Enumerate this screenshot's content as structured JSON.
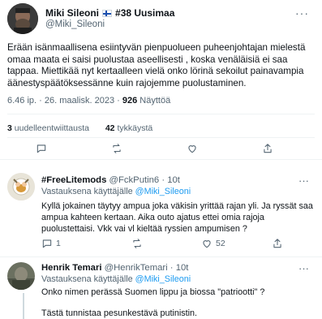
{
  "main_tweet": {
    "display_name": "Miki Sileoni",
    "badge": "#38 Uusimaa",
    "handle": "@Miki_Sileoni",
    "more_icon": "more-dots-icon",
    "text": "Erään isänmaallisena esiintyvän pienpuolueen puheenjohtajan mielestä omaa maata ei saisi puolustaa aseellisesti , koska venäläisiä ei saa tappaa. Miettikää nyt kertaalleen vielä onko lörinä sekoilut painavampia äänestyspäätöksessänne kuin rajojemme puolustaminen.",
    "time": "6.46 ip. · 26. maalisk. 2023 · ",
    "views_count": "926",
    "views_label": " Näyttöä",
    "retweets_count": "3",
    "retweets_label": " uudelleentwiittausta",
    "likes_count": "42",
    "likes_label": " tykkäystä"
  },
  "replies": [
    {
      "display_name": "#FreeLitemods",
      "handle_time": "@FckPutin6 · 10t",
      "replying_prefix": "Vastauksena käyttäjälle ",
      "replying_to": "@Miki_Sileoni",
      "text": "Kyllä jokainen täytyy ampua joka väkisin yrittää rajan yli. Ja ryssät saa ampua kahteen kertaan. Aika outo ajatus ettei omia rajoja puolustettaisi. Vkk vai vl kieltää ryssien ampumisen ?",
      "reply_count": "1",
      "like_count": "52"
    },
    {
      "display_name": "Henrik Temari",
      "handle_time": "@HenrikTemari · 10t",
      "replying_prefix": "Vastauksena käyttäjälle ",
      "replying_to": "@Miki_Sileoni",
      "text_1": "Onko nimen perässä Suomen lippu ja biossa \"patriootti\" ?",
      "text_2": "Tästä tunnistaa pesunkestävä putinistin."
    }
  ]
}
